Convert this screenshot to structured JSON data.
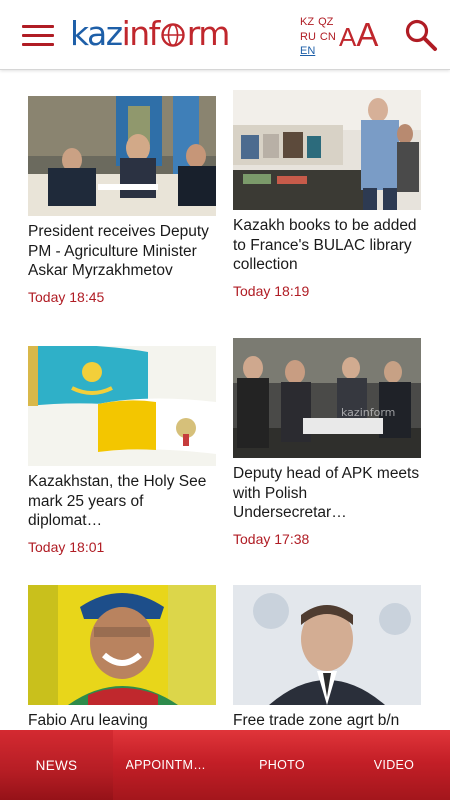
{
  "header": {
    "logo": {
      "part1": "kaz",
      "part2": "inf",
      "part3": "rm"
    },
    "languages": [
      {
        "code": "KZ",
        "active": false
      },
      {
        "code": "QZ",
        "active": false
      },
      {
        "code": "RU",
        "active": false
      },
      {
        "code": "CN",
        "active": false
      },
      {
        "code": "EN",
        "active": true
      }
    ],
    "font_size_label_small": "A",
    "font_size_label_big": "A",
    "icons": [
      "hamburger-menu-icon",
      "search-icon"
    ]
  },
  "articles": [
    {
      "title": "President receives Deputy PM - Agriculture Minister Askar Myrzakhmetov",
      "time": "Today 18:45",
      "image": "meeting-office-photo"
    },
    {
      "title": "Kazakh books to be added to France's BULAC library collection",
      "time": "Today 18:19",
      "image": "book-exhibition-photo"
    },
    {
      "title": "Kazakhstan, the Holy See mark 25 years of diplomat…",
      "time": "Today 18:01",
      "image": "kazakhstan-vatican-flags"
    },
    {
      "title": "Deputy head of APK meets with Polish Undersecretar…",
      "time": "Today 17:38",
      "image": "delegation-meeting-photo"
    },
    {
      "title": "Fabio Aru leaving",
      "time": "",
      "image": "cyclist-portrait-photo"
    },
    {
      "title": "Free trade zone agrt b/n",
      "time": "",
      "image": "apec-speaker-photo"
    }
  ],
  "bottom_nav": [
    {
      "label": "NEWS",
      "active": true
    },
    {
      "label": "APPOINTMEN…",
      "active": false
    },
    {
      "label": "PHOTO",
      "active": false
    },
    {
      "label": "VIDEO",
      "active": false
    }
  ],
  "colors": {
    "brand_red": "#b01c24",
    "brand_blue": "#1e5fa8",
    "nav_red": "#c41f27"
  }
}
